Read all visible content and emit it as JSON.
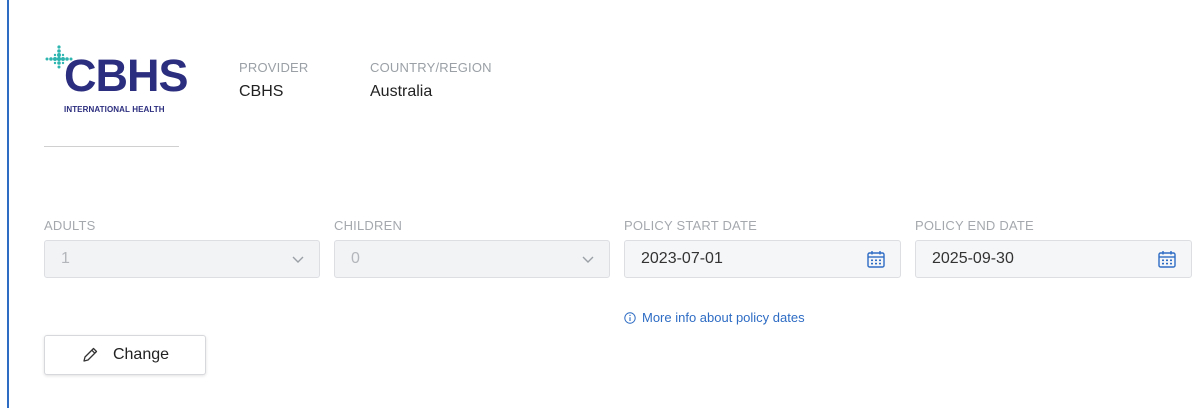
{
  "logo": {
    "name": "CBHS",
    "tagline": "INTERNATIONAL HEALTH",
    "colors": {
      "text": "#2b2d7e",
      "cross": "#2fb5b0"
    }
  },
  "provider": {
    "label": "PROVIDER",
    "value": "CBHS"
  },
  "country": {
    "label": "COUNTRY/REGION",
    "value": "Australia"
  },
  "fields": {
    "adults": {
      "label": "ADULTS",
      "value": "1",
      "icon": "chevron-down-icon"
    },
    "children": {
      "label": "CHILDREN",
      "value": "0",
      "icon": "chevron-down-icon"
    },
    "start_date": {
      "label": "POLICY START DATE",
      "value": "2023-07-01",
      "icon": "calendar-icon"
    },
    "end_date": {
      "label": "POLICY END DATE",
      "value": "2025-09-30",
      "icon": "calendar-icon"
    }
  },
  "info_link": {
    "label": "More info about policy dates",
    "icon": "info-icon"
  },
  "change_button": {
    "label": "Change",
    "icon": "pencil-icon"
  },
  "colors": {
    "accent": "#2e6cc4",
    "muted_text": "#a5a9ae",
    "border": "#dcdee2"
  }
}
